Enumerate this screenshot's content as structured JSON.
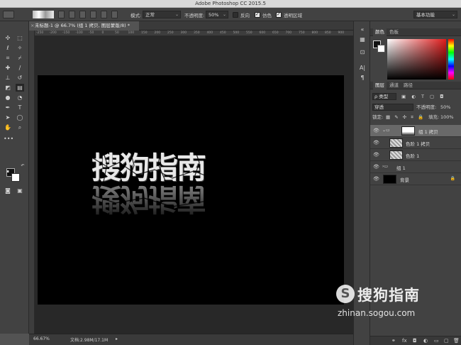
{
  "window": {
    "title": "Adobe Photoshop CC 2015.5"
  },
  "options_bar": {
    "mode_label": "模式:",
    "mode_value": "正常",
    "opacity_label": "不透明度:",
    "opacity_value": "50%",
    "reverse_label": "反向",
    "dither_label": "仿色",
    "transparency_label": "透明区域",
    "dither_checked": true,
    "transparency_checked": true,
    "reverse_checked": false,
    "workspace_value": "基本功能"
  },
  "document": {
    "tab_title": "未标题-1 @ 66.7% (组 1 拷贝, 图层蒙版/8) *",
    "canvas_text": "搜狗指南",
    "reflection_text": "搜狗指南"
  },
  "rulers": {
    "top_labels": [
      "-250",
      "-200",
      "-150",
      "-100",
      "-50",
      "0",
      "50",
      "100",
      "150",
      "200",
      "250",
      "300",
      "350",
      "400",
      "450",
      "500",
      "550",
      "600",
      "650",
      "700",
      "750",
      "800",
      "850",
      "900"
    ]
  },
  "status_bar": {
    "zoom": "66.67%",
    "doc_info": "文档:2.98M/17.1M",
    "arrow": "▸"
  },
  "color_panel": {
    "tabs": [
      "颜色",
      "色板"
    ]
  },
  "layers_panel": {
    "tabs": [
      "图层",
      "通道",
      "路径"
    ],
    "filter_label": "ρ 类型",
    "blend_mode": "穿透",
    "opacity_label": "不透明度:",
    "opacity_value": "50%",
    "lock_label": "锁定:",
    "fill_label": "填充:",
    "fill_value": "100%",
    "layers": [
      {
        "name": "组 1 拷贝",
        "selected": true
      },
      {
        "name": "色阶 1 拷贝",
        "selected": false
      },
      {
        "name": "色阶 1",
        "selected": false
      },
      {
        "name": "组 1",
        "selected": false
      },
      {
        "name": "背景",
        "selected": false
      }
    ],
    "footer_icons": [
      "link-icon",
      "fx-icon",
      "mask-icon",
      "adjustment-icon",
      "folder-icon",
      "new-layer-icon",
      "trash-icon"
    ],
    "footer_labels": [
      "⚭",
      "fx",
      "◘",
      "◐",
      "▭",
      "▢",
      "🗑"
    ]
  },
  "watermark": {
    "logo_glyph": "S",
    "brand": "搜狗指南",
    "url": "zhinan.sogou.com"
  },
  "colors": {
    "ui_dark": "#424242",
    "canvas_bg": "#000000",
    "accent_red": "#e01b1b"
  }
}
